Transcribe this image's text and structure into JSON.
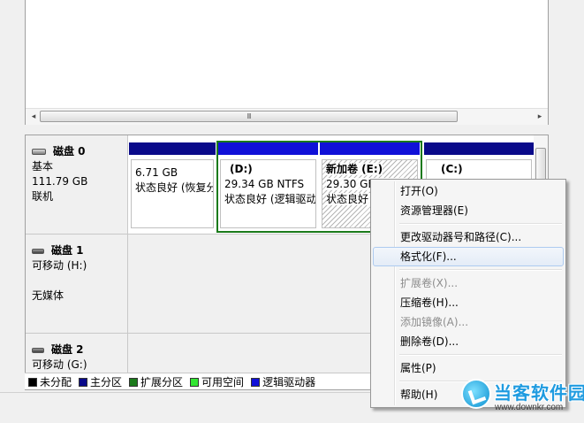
{
  "top_pane": {
    "scrollbar": {
      "left_arrow": "◂",
      "right_arrow": "▸",
      "grip": "III"
    }
  },
  "disks": [
    {
      "name": "磁盘 0",
      "type": "基本",
      "size": "111.79 GB",
      "status": "联机",
      "partitions": [
        {
          "line1": "6.71 GB",
          "line2": "状态良好 (恢复分",
          "volume": "",
          "bar": "dark",
          "hatched": false
        },
        {
          "volume": "(D:)",
          "line1": "29.34 GB NTFS",
          "line2": "状态良好 (逻辑驱动",
          "bar": "blue",
          "hatched": false
        },
        {
          "volume": "新加卷  (E:)",
          "line1": "29.30 GB NTFS",
          "line2": "状态良好 (逻辑驱",
          "bar": "blue",
          "hatched": true
        },
        {
          "volume": "(C:)",
          "line1": "",
          "line2": "",
          "bar": "dark",
          "hatched": false
        }
      ]
    },
    {
      "name": "磁盘 1",
      "type": "可移动 (H:)",
      "size": "",
      "status": "无媒体"
    },
    {
      "name": "磁盘 2",
      "type": "可移动 (G:)",
      "size": "",
      "status": ""
    }
  ],
  "legend": [
    {
      "label": "未分配",
      "color": "#000000"
    },
    {
      "label": "主分区",
      "color": "#0a0a8a"
    },
    {
      "label": "扩展分区",
      "color": "#1b7a1b"
    },
    {
      "label": "可用空间",
      "color": "#33e633"
    },
    {
      "label": "逻辑驱动器",
      "color": "#1010d8"
    }
  ],
  "context_menu": {
    "items": [
      {
        "label": "打开(O)",
        "enabled": true
      },
      {
        "label": "资源管理器(E)",
        "enabled": true
      },
      {
        "separator": true
      },
      {
        "label": "更改驱动器号和路径(C)...",
        "enabled": true
      },
      {
        "label": "格式化(F)...",
        "enabled": true,
        "highlight": true
      },
      {
        "separator": true
      },
      {
        "label": "扩展卷(X)...",
        "enabled": false
      },
      {
        "label": "压缩卷(H)...",
        "enabled": true
      },
      {
        "label": "添加镜像(A)...",
        "enabled": false
      },
      {
        "label": "删除卷(D)...",
        "enabled": true
      },
      {
        "separator": true
      },
      {
        "label": "属性(P)",
        "enabled": true
      },
      {
        "separator": true
      },
      {
        "label": "帮助(H)",
        "enabled": true
      }
    ]
  },
  "watermark": {
    "title": "当客软件园",
    "url": "www.downkr.com"
  }
}
